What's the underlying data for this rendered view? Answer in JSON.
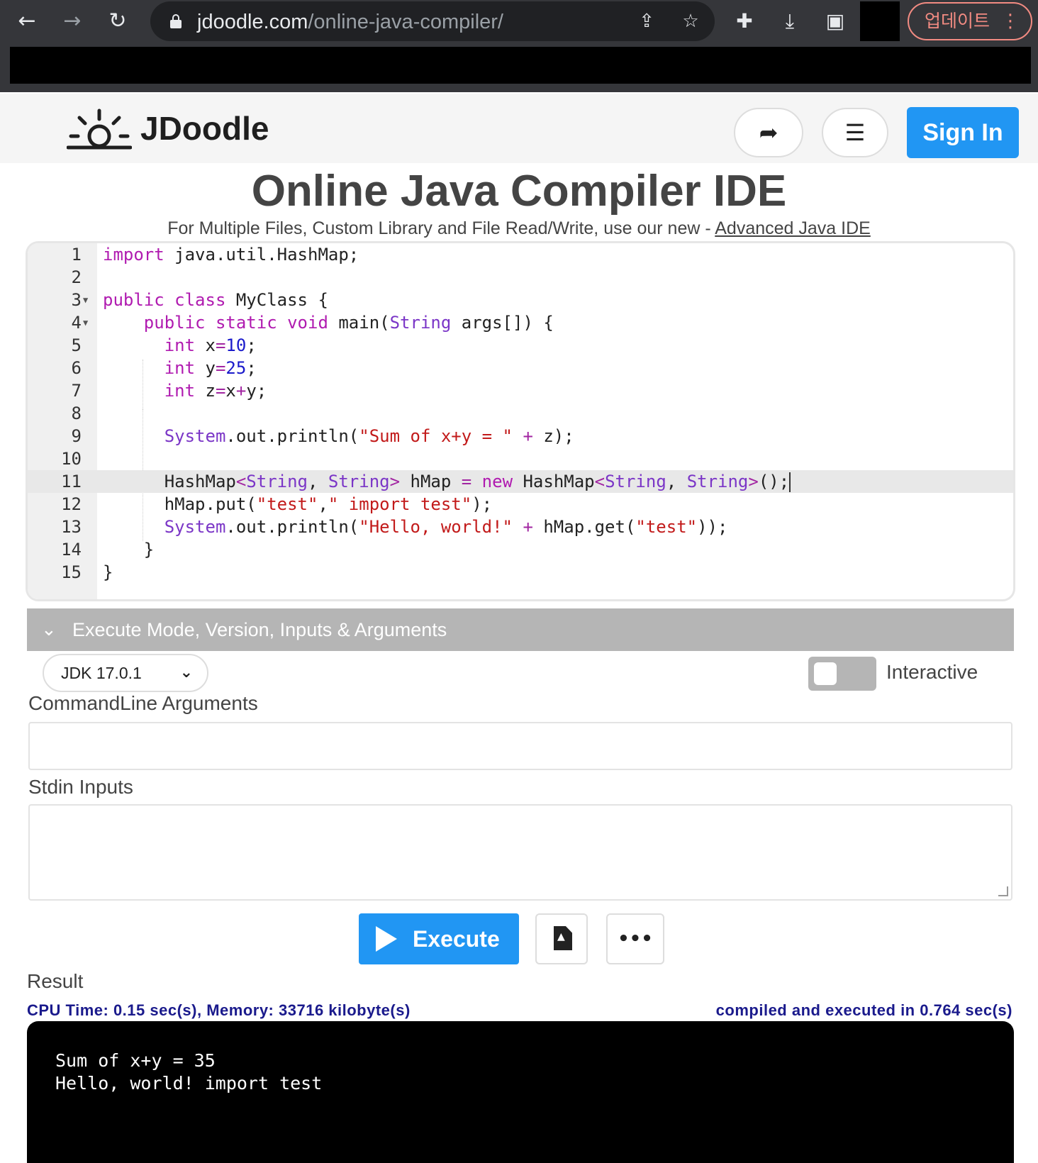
{
  "browser": {
    "url_host": "jdoodle.com",
    "url_path": "/online-java-compiler/",
    "update_label": "업데이트"
  },
  "header": {
    "logo_text": "JDoodle",
    "sign_in_label": "Sign In"
  },
  "page": {
    "title": "Online Java Compiler IDE",
    "subtitle_prefix": "For Multiple Files, Custom Library and File Read/Write, use our new - ",
    "subtitle_link": "Advanced Java IDE"
  },
  "editor": {
    "line_numbers": [
      "1",
      "2",
      "3",
      "4",
      "5",
      "6",
      "7",
      "8",
      "9",
      "10",
      "11",
      "12",
      "13",
      "14",
      "15"
    ],
    "active_line": 11,
    "code_text": [
      "import java.util.HashMap;",
      "",
      "public class MyClass {",
      "    public static void main(String args[]) {",
      "      int x=10;",
      "      int y=25;",
      "      int z=x+y;",
      "",
      "      System.out.println(\"Sum of x+y = \" + z);",
      "",
      "      HashMap<String, String> hMap = new HashMap<String, String>();",
      "      hMap.put(\"test\",\" import test\");",
      "      System.out.println(\"Hello, world!\" + hMap.get(\"test\"));",
      "    }",
      "}"
    ]
  },
  "execute_panel": {
    "header_label": "Execute Mode, Version, Inputs & Arguments",
    "jdk_version": "JDK 17.0.1",
    "interactive_label": "Interactive",
    "interactive_on": false,
    "cmdline_label": "CommandLine Arguments",
    "cmdline_value": "",
    "stdin_label": "Stdin Inputs",
    "stdin_value": "",
    "execute_label": "Execute"
  },
  "result": {
    "label": "Result",
    "cpu_info": "CPU Time: 0.15 sec(s), Memory: 33716 kilobyte(s)",
    "compiled_info": "compiled and executed in 0.764 sec(s)",
    "output_lines": [
      "Sum of x+y = 35",
      "Hello, world! import test"
    ]
  },
  "colors": {
    "brand_blue": "#2196f3",
    "keyword": "#b01bb0",
    "string": "#c21a1a",
    "number": "#1a1acb",
    "info_text": "#1a1a8c"
  }
}
